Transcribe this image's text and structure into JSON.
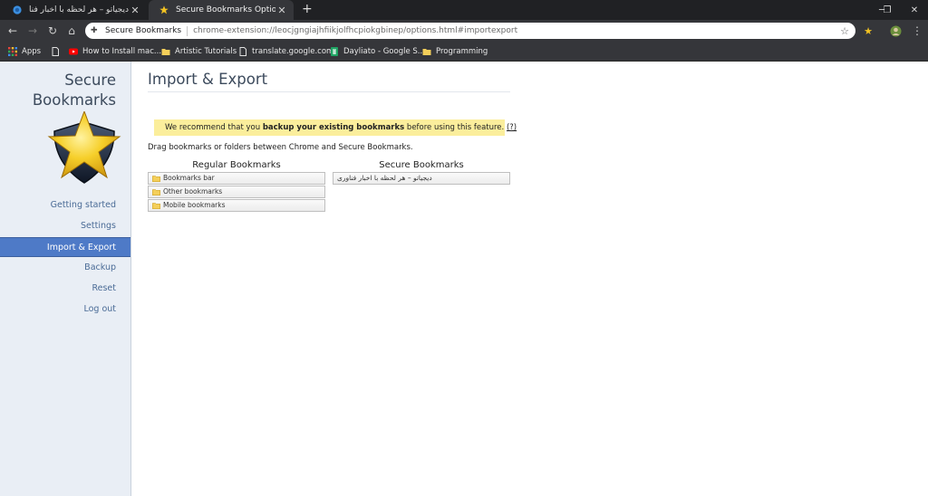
{
  "browser": {
    "tabs": [
      {
        "title": "دیجیاتو – هر لحظه با اخبار فناوری",
        "active": false
      },
      {
        "title": "Secure Bookmarks Options",
        "active": true
      }
    ],
    "omnibox": {
      "site_label": "Secure Bookmarks",
      "url": "chrome-extension://leocjgngiajhfiikjolfhcpiokgbinep/options.html#importexport"
    },
    "bookmarks": [
      {
        "label": "Apps"
      },
      {
        "label": ""
      },
      {
        "label": "How to Install mac..."
      },
      {
        "label": "Artistic Tutorials"
      },
      {
        "label": "translate.google.com"
      },
      {
        "label": "Dayliato - Google S..."
      },
      {
        "label": "Programming"
      }
    ]
  },
  "sidebar": {
    "brand_line1": "Secure",
    "brand_line2": "Bookmarks",
    "items": [
      {
        "label": "Getting started",
        "active": false
      },
      {
        "label": "Settings",
        "active": false
      },
      {
        "label": "Import & Export",
        "active": true
      },
      {
        "label": "Backup",
        "active": false
      },
      {
        "label": "Reset",
        "active": false
      },
      {
        "label": "Log out",
        "active": false
      }
    ]
  },
  "main": {
    "title": "Import & Export",
    "notice": {
      "prefix": "We recommend that you ",
      "bold": "backup your existing bookmarks",
      "suffix": " before using this feature. ",
      "link": "(?)"
    },
    "hint": "Drag bookmarks or folders between Chrome and Secure Bookmarks.",
    "regular": {
      "heading": "Regular Bookmarks",
      "folders": [
        "Bookmarks bar",
        "Other bookmarks",
        "Mobile bookmarks"
      ]
    },
    "secure": {
      "heading": "Secure Bookmarks",
      "folders": [
        "دیجیاتو – هر لحظه با اخبار فناوری"
      ]
    }
  },
  "colors": {
    "accent": "#4e7ac7",
    "notice_bg": "#fbee9c",
    "sidebar_bg": "#e9eef5",
    "chrome_dark": "#35363a"
  }
}
